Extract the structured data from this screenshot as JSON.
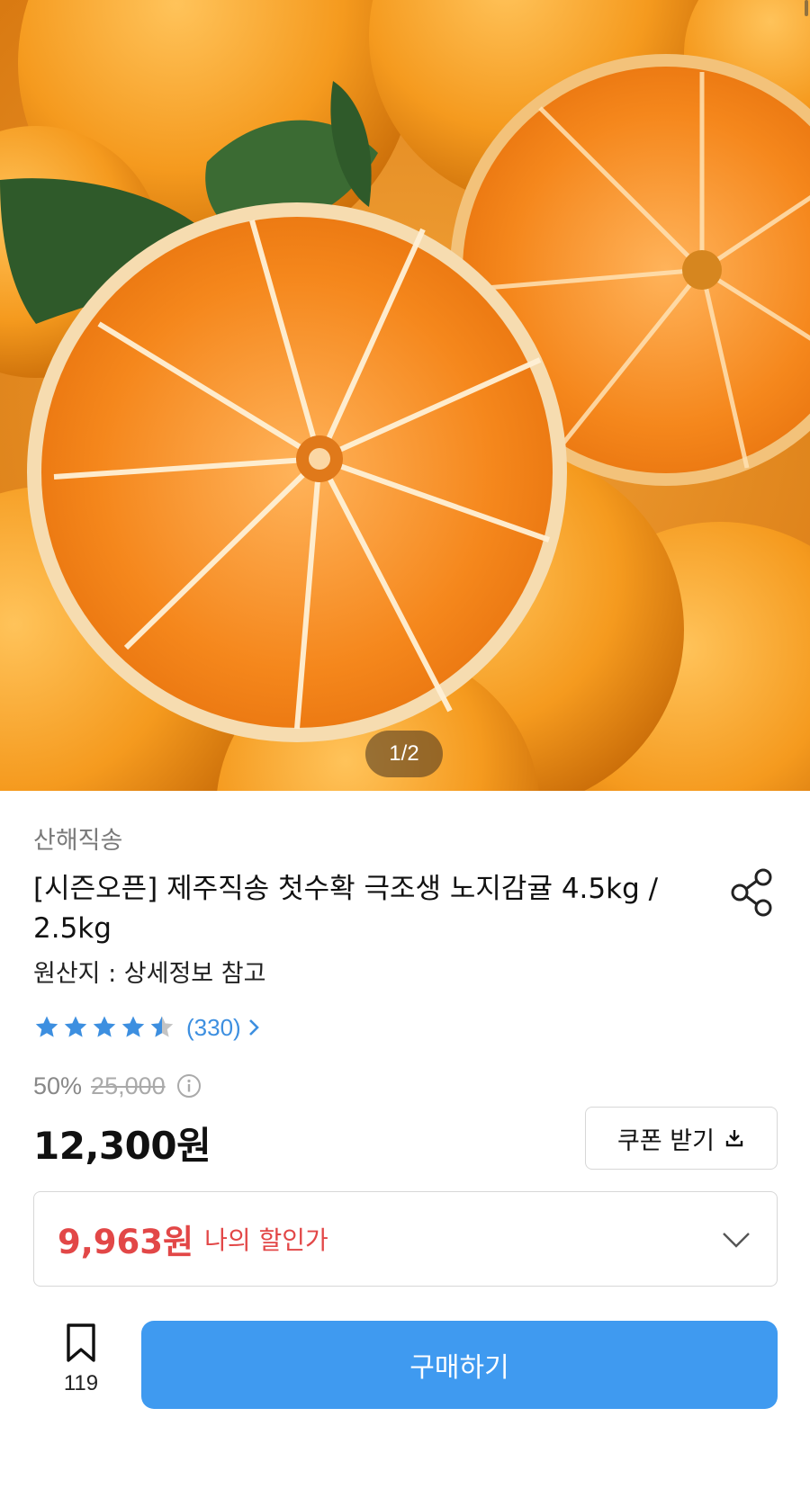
{
  "gallery": {
    "current": "1",
    "total": "2",
    "separator": "/"
  },
  "product": {
    "seller": "산해직송",
    "title": "[시즌오픈] 제주직송 첫수확 극조생 노지감귤 4.5kg / 2.5kg",
    "origin": "원산지 : 상세정보 참고",
    "rating": 4.5,
    "review_count": "(330)",
    "discount_rate": "50%",
    "original_price": "25,000",
    "price": "12,300원"
  },
  "coupon": {
    "label": "쿠폰 받기",
    "icon": "download-icon"
  },
  "my_price": {
    "amount": "9,963원",
    "label": "나의 할인가"
  },
  "bookmark": {
    "count": "119",
    "icon": "bookmark-icon"
  },
  "buy_button": {
    "label": "구매하기"
  },
  "colors": {
    "accent": "#3f9af0",
    "discount_red": "#e24747",
    "star_blue": "#3d8fe0",
    "star_gray": "#c4c4c4"
  }
}
